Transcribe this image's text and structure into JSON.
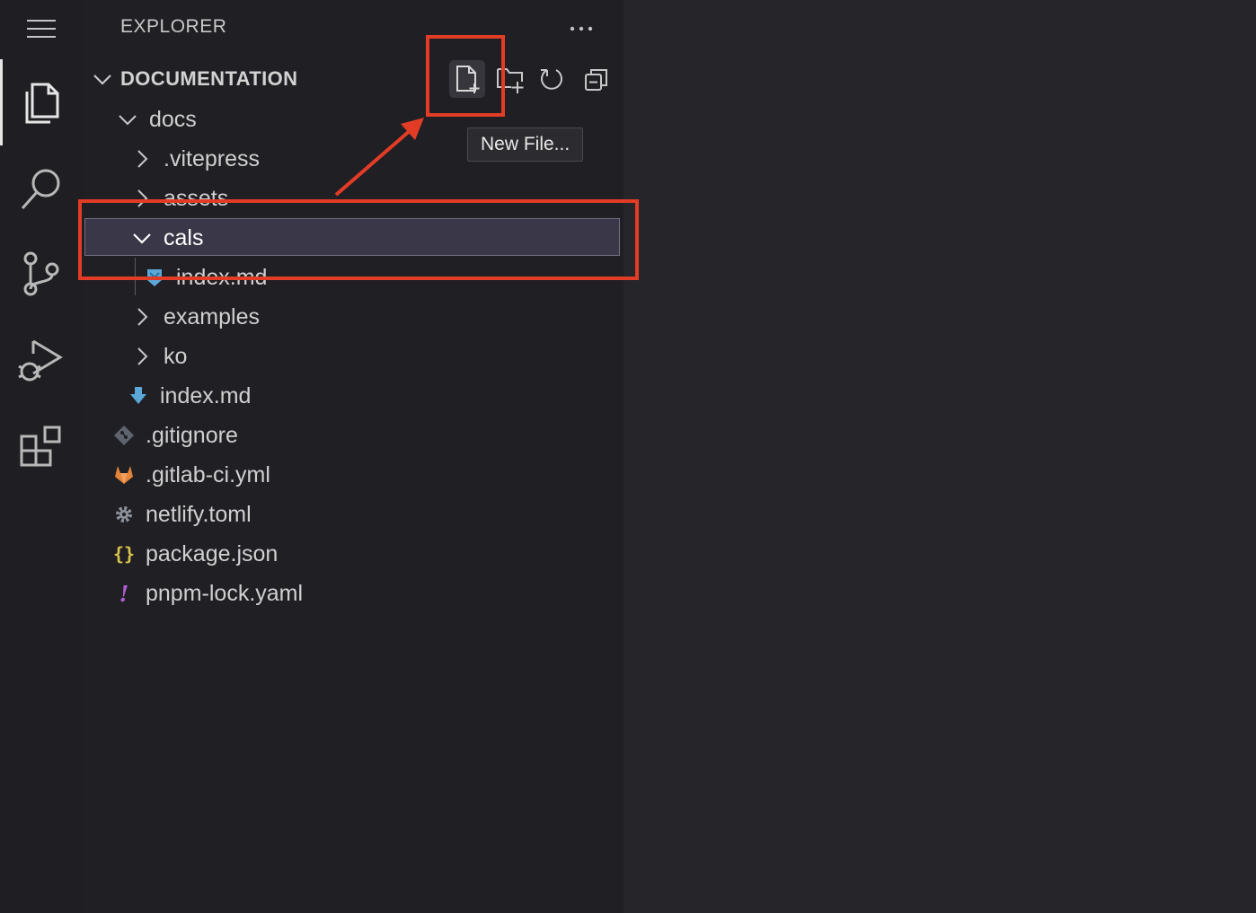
{
  "activity_bar": {
    "items": [
      {
        "icon": "menu-icon"
      },
      {
        "icon": "files-icon",
        "active": true
      },
      {
        "icon": "search-icon"
      },
      {
        "icon": "source-control-icon"
      },
      {
        "icon": "run-debug-icon"
      },
      {
        "icon": "extensions-icon"
      }
    ]
  },
  "sidebar": {
    "title": "EXPLORER",
    "section": "DOCUMENTATION",
    "toolbar": {
      "buttons": [
        {
          "icon": "new-file-icon"
        },
        {
          "icon": "new-folder-icon"
        },
        {
          "icon": "refresh-icon"
        },
        {
          "icon": "collapse-all-icon"
        }
      ],
      "tooltip": "New File..."
    },
    "tree": [
      {
        "label": "docs"
      },
      {
        "label": ".vitepress"
      },
      {
        "label": "assets"
      },
      {
        "label": "cals"
      },
      {
        "label": "index.md"
      },
      {
        "label": "examples"
      },
      {
        "label": "ko"
      },
      {
        "label": "index.md"
      },
      {
        "label": ".gitignore"
      },
      {
        "label": ".gitlab-ci.yml"
      },
      {
        "label": "netlify.toml"
      },
      {
        "label": "package.json"
      },
      {
        "label": "pnpm-lock.yaml"
      }
    ]
  },
  "colors": {
    "accent_annotation": "#e23c27",
    "markdown_icon": "#5aa7d8",
    "gitlab_icon": "#e2843a",
    "json_icon": "#d6c44a",
    "yaml_icon": "#b05fd3",
    "selection_bg": "#3a3848"
  }
}
